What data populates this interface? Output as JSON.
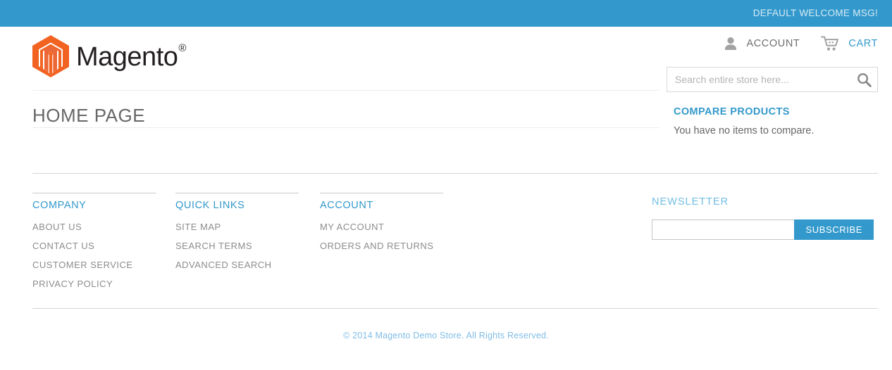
{
  "topbar": {
    "welcome_message": "DEFAULT WELCOME MSG!"
  },
  "brand": {
    "name": "Magento",
    "registered_mark": "®",
    "logo_icon": "magento-hexagon-logo"
  },
  "header": {
    "account_link": {
      "label": "ACCOUNT",
      "icon": "user-icon"
    },
    "cart_link": {
      "label": "CART",
      "icon": "shopping-cart-icon"
    }
  },
  "search": {
    "placeholder": "Search entire store here...",
    "value": "",
    "icon": "search-icon"
  },
  "main": {
    "page_title": "HOME PAGE"
  },
  "sidebar": {
    "compare_products": {
      "heading": "COMPARE PRODUCTS",
      "empty_message": "You have no items to compare."
    }
  },
  "footer": {
    "columns": [
      {
        "heading": "COMPANY",
        "links": [
          "ABOUT US",
          "CONTACT US",
          "CUSTOMER SERVICE",
          "PRIVACY POLICY"
        ]
      },
      {
        "heading": "QUICK LINKS",
        "links": [
          "SITE MAP",
          "SEARCH TERMS",
          "ADVANCED SEARCH"
        ]
      },
      {
        "heading": "ACCOUNT",
        "links": [
          "MY ACCOUNT",
          "ORDERS AND RETURNS"
        ]
      }
    ],
    "newsletter": {
      "heading": "NEWSLETTER",
      "input_value": "",
      "input_placeholder": "",
      "subscribe_label": "SUBSCRIBE"
    },
    "copyright": "© 2014 Magento Demo Store. All Rights Reserved."
  },
  "colors": {
    "brand_blue": "#3399cc",
    "brand_orange": "#f26322",
    "welcome_text": "#d6eaf5",
    "muted_text": "#8c8c8c",
    "title_text": "#676767",
    "copyright_text": "#7fbde6"
  }
}
